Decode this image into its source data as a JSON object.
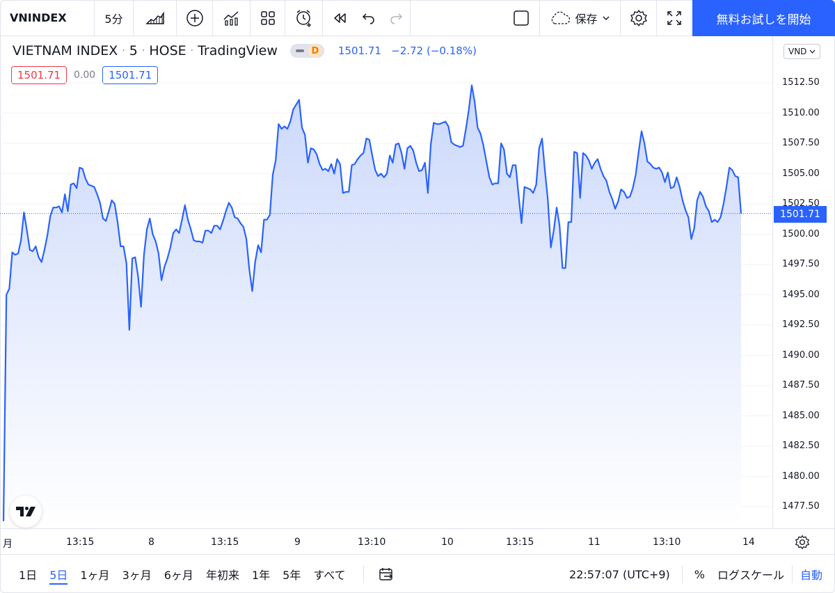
{
  "toolbar": {
    "symbol": "VNINDEX",
    "interval": "5分",
    "save_label": "保存",
    "cta_label": "無料お試しを開始"
  },
  "legend": {
    "title": "VIETNAM INDEX",
    "interval": "5",
    "exchange": "HOSE",
    "source": "TradingView",
    "badge": "D",
    "last": "1501.71",
    "change": "−2.72",
    "change_pct": "(−0.18%)",
    "bid": "1501.71",
    "spread": "0.00",
    "ask": "1501.71"
  },
  "price_axis": {
    "currency": "VND",
    "labels": [
      "1512.50",
      "1510.00",
      "1507.50",
      "1505.00",
      "1502.50",
      "1500.00",
      "1497.50",
      "1495.00",
      "1492.50",
      "1490.00",
      "1487.50",
      "1485.00",
      "1482.50",
      "1480.00",
      "1477.50"
    ],
    "last_price_label": "1501.71"
  },
  "time_axis": {
    "labels": [
      "月",
      "13:15",
      "8",
      "13:15",
      "9",
      "13:10",
      "10",
      "13:15",
      "11",
      "13:10",
      "14"
    ]
  },
  "bottom_bar": {
    "ranges": [
      "1日",
      "5日",
      "1ヶ月",
      "3ヶ月",
      "6ヶ月",
      "年初来",
      "1年",
      "5年",
      "すべて"
    ],
    "active_range": "5日",
    "clock": "22:57:07 (UTC+9)",
    "percent": "%",
    "log_scale": "ログスケール",
    "auto": "自動"
  },
  "colors": {
    "line": "#2962ff",
    "fill_top": "#c8d6fb",
    "fill_bottom": "#ffffff",
    "accent": "#2962ff",
    "down": "#f23645"
  },
  "chart_data": {
    "type": "area",
    "title": "VIETNAM INDEX · 5 · HOSE",
    "xlabel": "",
    "ylabel": "",
    "ylim": [
      1476,
      1515
    ],
    "x_ticks": [
      "月",
      "13:15",
      "8",
      "13:15",
      "9",
      "13:10",
      "10",
      "13:15",
      "11",
      "13:10",
      "14"
    ],
    "series": [
      {
        "values": [
          1476.3,
          1495.0,
          1495.5,
          1498.5,
          1498.3,
          1498.4,
          1499.5,
          1501.8,
          1500.3,
          1498.7,
          1498.6,
          1499.0,
          1498.1,
          1497.7,
          1498.7,
          1499.9,
          1501.5,
          1502.2,
          1502.2,
          1502.3,
          1501.8,
          1503.3,
          1501.9,
          1504.1,
          1504.2,
          1503.8,
          1505.5,
          1505.4,
          1504.6,
          1504.1,
          1504.0,
          1503.9,
          1503.3,
          1502.6,
          1501.3,
          1501.1,
          1501.9,
          1502.8,
          1502.5,
          1501.0,
          1499.0,
          1499.0,
          1497.6,
          1492.1,
          1498.0,
          1498.1,
          1496.5,
          1494.0,
          1498.3,
          1500.4,
          1501.3,
          1500.0,
          1499.4,
          1498.4,
          1496.2,
          1497.3,
          1498.0,
          1498.9,
          1500.1,
          1500.4,
          1500.1,
          1501.2,
          1502.4,
          1501.2,
          1500.4,
          1499.5,
          1499.4,
          1499.4,
          1499.3,
          1500.3,
          1500.3,
          1500.1,
          1500.7,
          1500.7,
          1500.4,
          1501.1,
          1501.9,
          1502.6,
          1502.2,
          1501.4,
          1501.3,
          1500.9,
          1500.6,
          1499.6,
          1497.1,
          1495.3,
          1497.7,
          1499.1,
          1498.5,
          1501.2,
          1501.2,
          1501.6,
          1504.9,
          1506.1,
          1509.1,
          1508.7,
          1508.9,
          1508.7,
          1509.3,
          1510.3,
          1510.7,
          1511.1,
          1508.8,
          1508.2,
          1505.9,
          1507.1,
          1507.0,
          1506.6,
          1505.8,
          1505.3,
          1505.4,
          1505.2,
          1505.8,
          1505.0,
          1506.2,
          1505.8,
          1503.4,
          1503.5,
          1503.5,
          1505.7,
          1505.8,
          1506.2,
          1506.5,
          1506.7,
          1507.9,
          1507.8,
          1506.5,
          1505.3,
          1504.8,
          1505.0,
          1504.7,
          1505.0,
          1506.5,
          1505.9,
          1507.4,
          1507.5,
          1506.7,
          1505.4,
          1507.1,
          1507.3,
          1506.9,
          1505.9,
          1505.2,
          1505.3,
          1505.9,
          1503.4,
          1507.4,
          1509.2,
          1509.1,
          1509.1,
          1509.2,
          1509.3,
          1508.9,
          1507.6,
          1507.4,
          1507.3,
          1507.2,
          1507.3,
          1508.7,
          1510.3,
          1512.3,
          1510.9,
          1508.8,
          1508.3,
          1507.3,
          1506.0,
          1504.7,
          1504.1,
          1504.2,
          1504.2,
          1507.5,
          1507.0,
          1505.0,
          1504.7,
          1505.7,
          1505.7,
          1503.2,
          1500.9,
          1503.9,
          1503.8,
          1503.7,
          1503.4,
          1504.1,
          1507.1,
          1507.9,
          1505.2,
          1502.8,
          1498.9,
          1500.3,
          1502.2,
          1500.7,
          1497.2,
          1497.2,
          1501.0,
          1501.0,
          1506.8,
          1506.7,
          1503.0,
          1506.7,
          1506.5,
          1506.1,
          1505.4,
          1505.9,
          1506.2,
          1505.4,
          1504.8,
          1504.4,
          1503.5,
          1502.9,
          1502.1,
          1502.7,
          1503.7,
          1503.5,
          1503.0,
          1503.1,
          1503.8,
          1504.9,
          1506.8,
          1508.5,
          1507.5,
          1506.0,
          1505.8,
          1505.5,
          1505.4,
          1505.5,
          1505.1,
          1504.3,
          1505.1,
          1503.8,
          1503.9,
          1504.7,
          1503.9,
          1502.8,
          1502.0,
          1501.4,
          1499.6,
          1500.5,
          1502.8,
          1503.5,
          1503.1,
          1502.3,
          1501.9,
          1501.0,
          1501.2,
          1501.0,
          1501.4,
          1502.5,
          1503.9,
          1505.5,
          1505.3,
          1504.8,
          1504.7,
          1501.7
        ]
      }
    ]
  }
}
